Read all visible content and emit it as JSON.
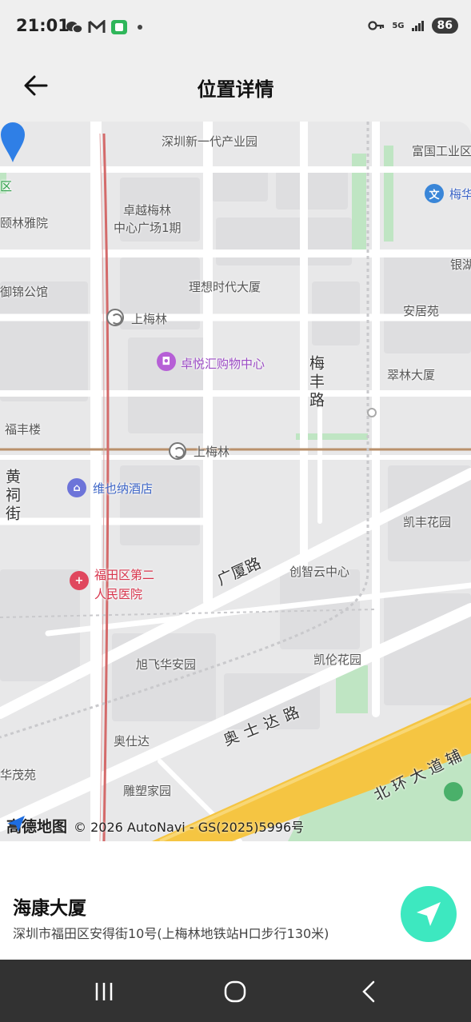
{
  "status_bar": {
    "time": "21:01",
    "battery": "86",
    "network": "5G",
    "icons_left": [
      "wechat-icon",
      "gmail-icon",
      "chat-app-icon",
      "dot-icon"
    ],
    "icons_right": [
      "key-icon",
      "5g-icon",
      "signal-icon",
      "battery-icon"
    ]
  },
  "header": {
    "title": "位置详情",
    "back_icon": "arrow-left-icon"
  },
  "map": {
    "provider_logo": "高德地图",
    "copyright": "© 2026 AutoNavi - GS(2025)5996号",
    "labels": {
      "industrial_park": "深圳新一代产业园",
      "fuguo": "富国工业区",
      "meihua": "梅华",
      "zhuoyue": "卓越梅林",
      "zhuoyue2": "中心广场1期",
      "yilin": "颐林雅院",
      "yin": "银湖",
      "yujin": "御锦公馆",
      "lixiang": "理想时代大厦",
      "anjuyuan": "安居苑",
      "shangmeilin": "上梅林",
      "zhuoyue_mall": "卓悦汇购物中心",
      "meifeng_road": "梅丰路",
      "cuilin": "翠林大厦",
      "fengfeng": "福丰楼",
      "shangmeilin2": "上梅林",
      "huangci": "黄祠街",
      "vienna": "维也纳酒店",
      "kaifeng": "凯丰花园",
      "guangsha": "广厦路",
      "chuangzhi": "创智云中心",
      "hospital1": "福田区第二",
      "hospital2": "人民医院",
      "xufei": "旭飞华安园",
      "kailun": "凯伦花园",
      "aoshida_road": "奥士达路",
      "aoshida": "奥仕达",
      "maohuayuan": "华茂苑",
      "beihuan": "北环大道辅",
      "diaosu": "雕塑家园",
      "ou": "区"
    }
  },
  "place": {
    "name": "海康大厦",
    "address": "深圳市福田区安得街10号(上梅林地铁站H口步行130米)"
  },
  "colors": {
    "accent": "#3de8c0",
    "pin": "#2f7fe6",
    "metro_line": "#d46a6a",
    "highway": "#f5c542",
    "park": "#bfe5c3"
  },
  "system_nav": [
    "recents-icon",
    "home-icon",
    "back-icon"
  ]
}
